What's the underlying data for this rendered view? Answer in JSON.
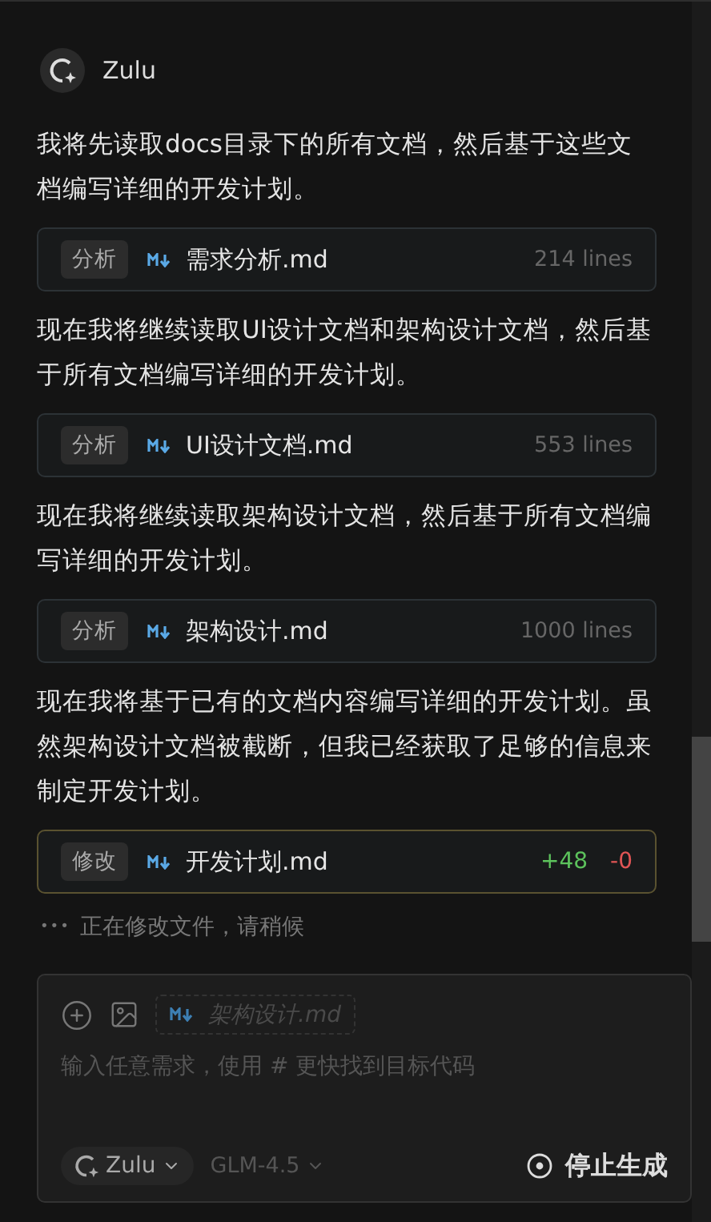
{
  "assistant": {
    "name": "Zulu"
  },
  "messages": [
    {
      "kind": "text",
      "text": "我将先读取docs目录下的所有文档，然后基于这些文档编写详细的开发计划。"
    },
    {
      "kind": "read",
      "tag": "分析",
      "file": "需求分析.md",
      "lines": "214 lines"
    },
    {
      "kind": "text",
      "text": "现在我将继续读取UI设计文档和架构设计文档，然后基于所有文档编写详细的开发计划。"
    },
    {
      "kind": "read",
      "tag": "分析",
      "file": "UI设计文档.md",
      "lines": "553 lines"
    },
    {
      "kind": "text",
      "text": "现在我将继续读取架构设计文档，然后基于所有文档编写详细的开发计划。"
    },
    {
      "kind": "read",
      "tag": "分析",
      "file": "架构设计.md",
      "lines": "1000 lines"
    },
    {
      "kind": "text",
      "text": "现在我将基于已有的文档内容编写详细的开发计划。虽然架构设计文档被截断，但我已经获取了足够的信息来制定开发计划。"
    },
    {
      "kind": "edit",
      "tag": "修改",
      "file": "开发计划.md",
      "added": "+48",
      "removed": "-0"
    }
  ],
  "status": {
    "ellipsis": "•••",
    "text": "正在修改文件，请稍候"
  },
  "composer": {
    "attachment": "架构设计.md",
    "placeholder": "输入任意需求，使用 # 更快找到目标代码",
    "agent": "Zulu",
    "model": "GLM-4.5",
    "stop_button": "停止生成"
  }
}
